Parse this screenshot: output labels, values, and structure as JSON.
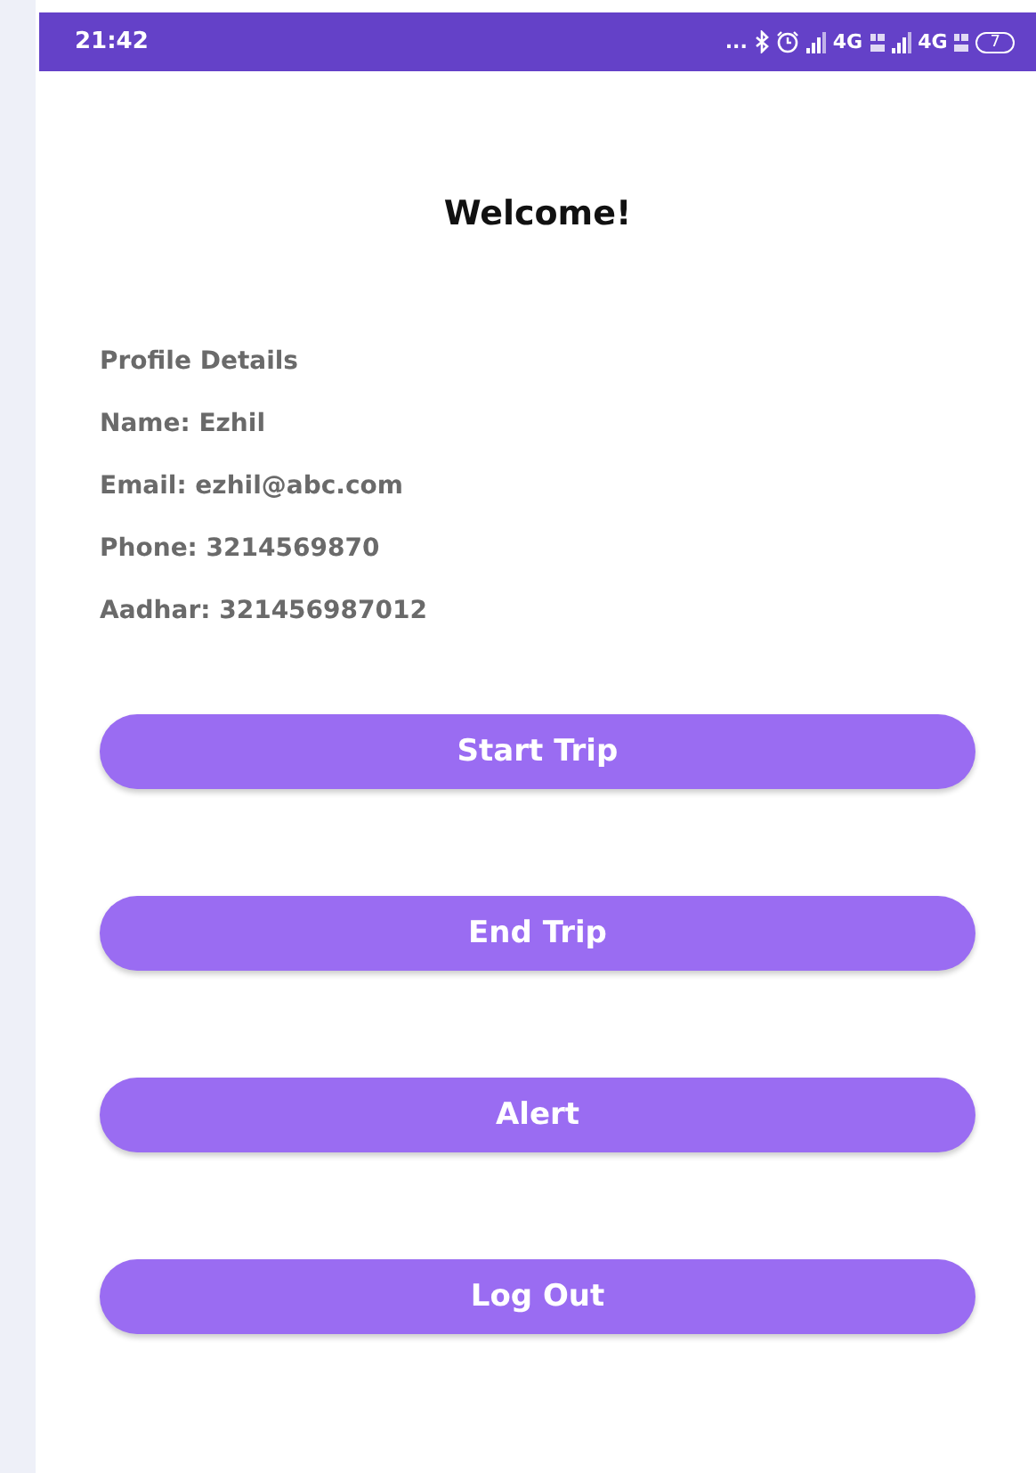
{
  "status_bar": {
    "time": "21:42",
    "more": "...",
    "network_1": "4G",
    "network_2": "4G",
    "battery": "7"
  },
  "title": "Welcome!",
  "profile": {
    "heading": "Profile Details",
    "lines": [
      "Name: Ezhil",
      "Email: ezhil@abc.com",
      "Phone: 3214569870",
      "Aadhar: 321456987012"
    ]
  },
  "buttons": [
    "Start Trip",
    "End Trip",
    "Alert",
    "Log Out"
  ]
}
